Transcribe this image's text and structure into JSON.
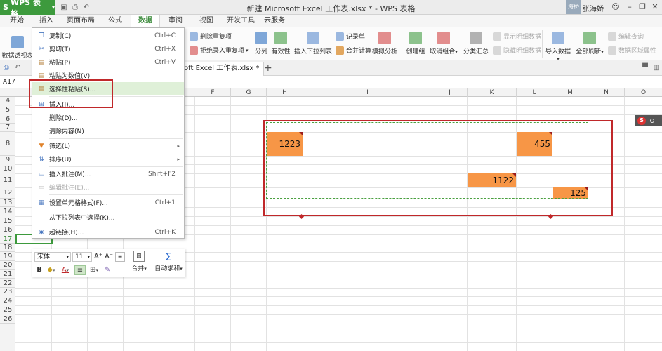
{
  "app": {
    "name": "WPS 表格",
    "logo_letter": "S"
  },
  "window_title": "新建 Microsoft Excel 工作表.xlsx * - WPS 表格",
  "user": {
    "avatar_text": "海桥",
    "name": "张海娇"
  },
  "menu_tabs": [
    "开始",
    "插入",
    "页面布局",
    "公式",
    "数据",
    "审阅",
    "视图",
    "开发工具",
    "云服务"
  ],
  "active_tab": "数据",
  "ribbon": {
    "pivot": "数据透视表",
    "dup_delete": "删除重复项",
    "reject_dup": "拒绝录入重复项",
    "split": "分列",
    "validity": "有效性",
    "dropdown": "插入下拉列表",
    "record": "记录单",
    "merge_calc": "合并计算",
    "simulate": "模拟分析",
    "create_group": "创建组",
    "ungroup": "取消组合",
    "subtotal": "分类汇总",
    "show_detail": "显示明细数据",
    "hide_detail": "隐藏明细数据",
    "import": "导入数据",
    "refresh_all": "全部刷新",
    "edit_query": "编辑查询",
    "area_attr": "数据区域属性"
  },
  "doc_tab": "oft Excel 工作表.xlsx *",
  "name_box": "A17",
  "columns": [
    "F",
    "G",
    "H",
    "I",
    "J",
    "K",
    "L",
    "M",
    "N",
    "O"
  ],
  "rows": [
    "4",
    "5",
    "6",
    "7",
    "8",
    "9",
    "10",
    "11",
    "12",
    "13",
    "14",
    "15",
    "16",
    "17",
    "18",
    "19",
    "20",
    "21",
    "22",
    "23",
    "24",
    "25",
    "26"
  ],
  "cells": {
    "h8": "1223",
    "l8": "455",
    "k11": "1122",
    "m12": "125"
  },
  "context_menu": {
    "copy": "复制(C)",
    "copy_sc": "Ctrl+C",
    "cut": "剪切(T)",
    "cut_sc": "Ctrl+X",
    "paste": "粘贴(P)",
    "paste_sc": "Ctrl+V",
    "paste_values": "粘贴为数值(V)",
    "paste_special": "选择性粘贴(S)...",
    "insert": "插入(I)...",
    "delete": "删除(D)...",
    "clear": "清除内容(N)",
    "filter": "筛选(L)",
    "sort": "排序(U)",
    "insert_comment": "插入批注(M)...",
    "insert_comment_sc": "Shift+F2",
    "edit_comment": "编辑批注(E)...",
    "format_cells": "设置单元格格式(F)...",
    "format_cells_sc": "Ctrl+1",
    "pick_from_list": "从下拉列表中选择(K)...",
    "hyperlink": "超链接(H)...",
    "hyperlink_sc": "Ctrl+K"
  },
  "mini_toolbar": {
    "font": "宋体",
    "size": "11",
    "grow": "A⁺",
    "shrink": "A⁻",
    "bold": "B",
    "merge": "合并",
    "autosum": "自动求和"
  },
  "colors": {
    "brand": "#3d9a3d",
    "highlight_cell": "#f79646",
    "annotation": "#c0282a"
  }
}
